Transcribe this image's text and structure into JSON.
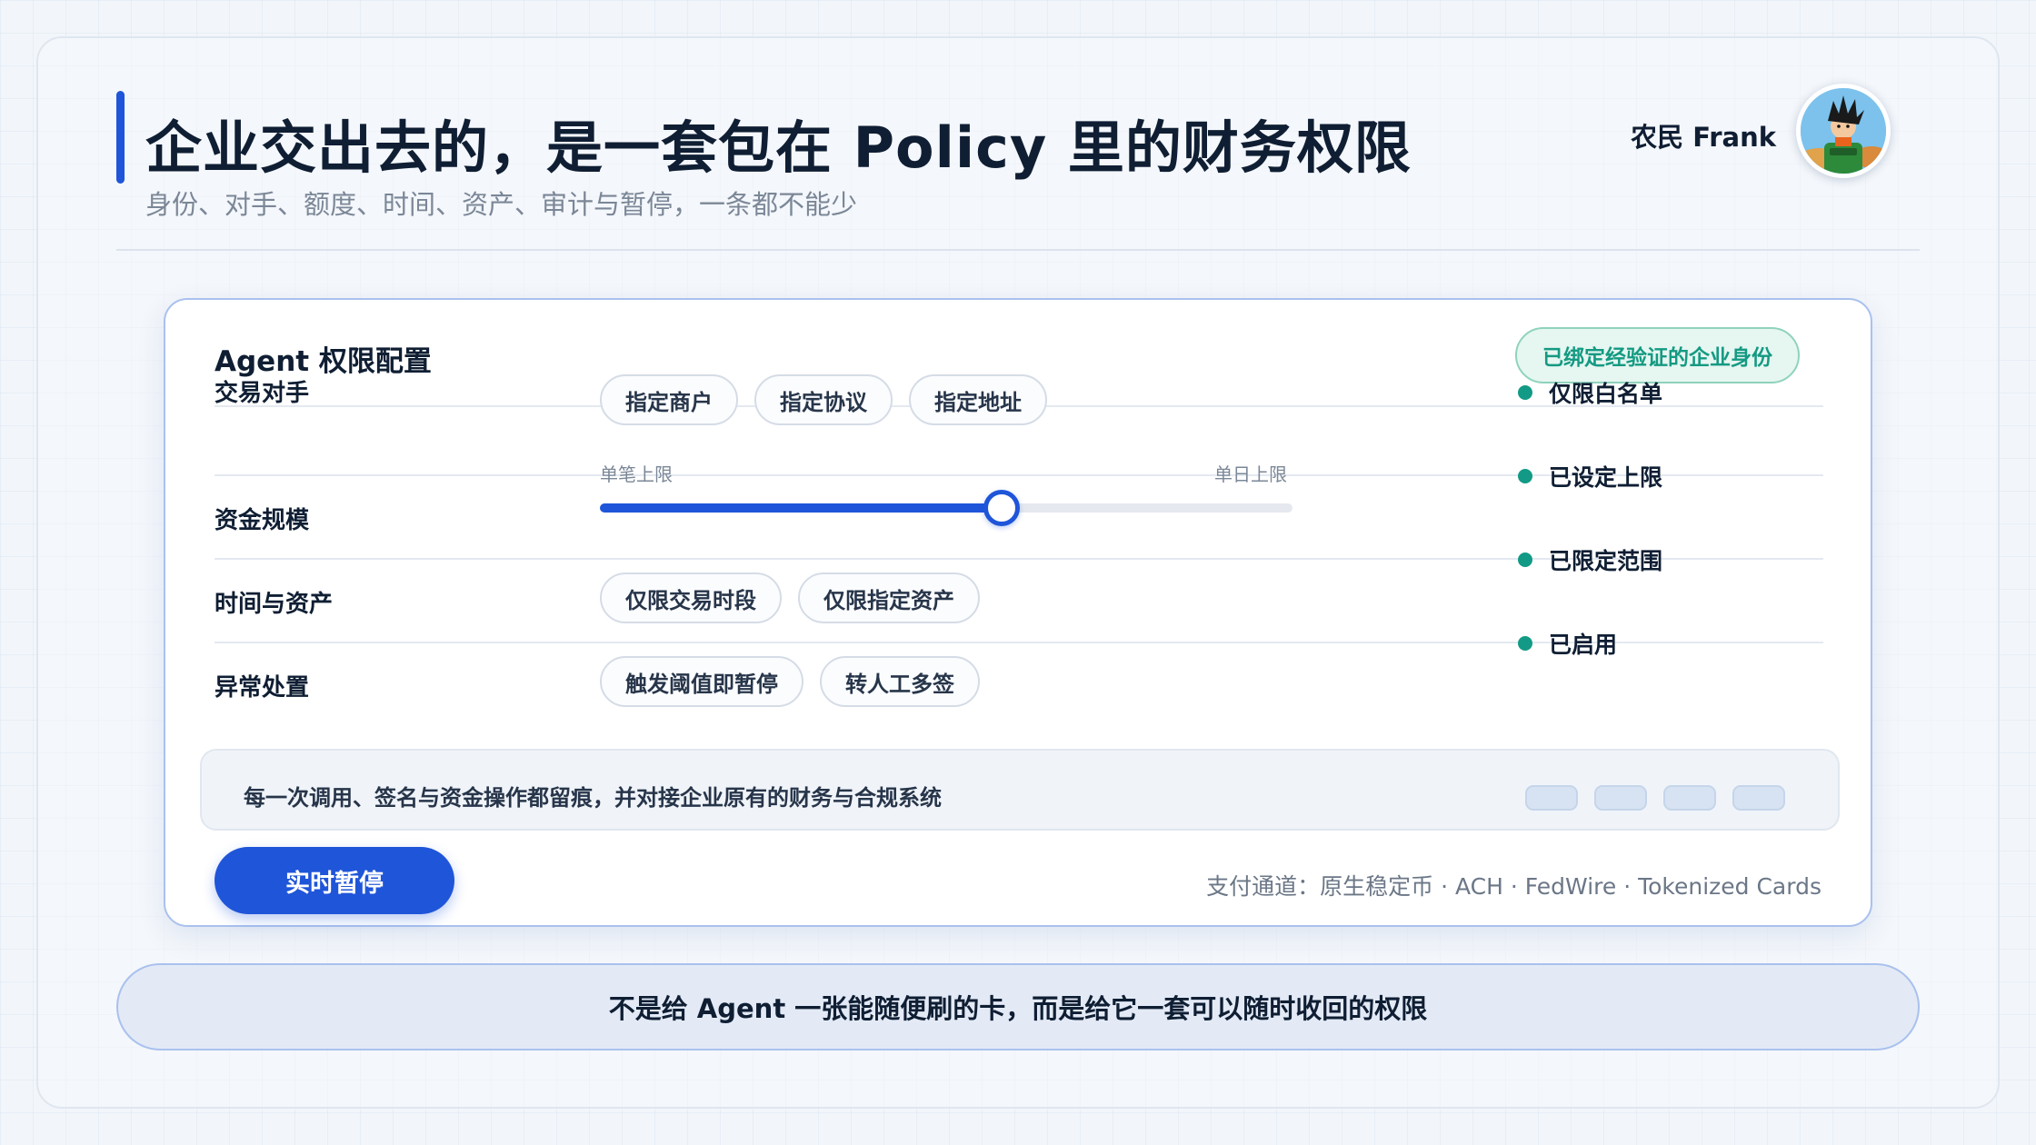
{
  "header": {
    "title": "企业交出去的，是一套包在 Policy 里的财务权限",
    "subtitle": "身份、对手、额度、时间、资产、审计与暂停，一条都不能少",
    "author": "农民 Frank",
    "avatar_icon": "cartoon-avatar-icon"
  },
  "card": {
    "title": "Agent 权限配置",
    "badge": "已绑定经验证的企业身份",
    "rows": [
      {
        "label": "交易对手",
        "chips": [
          "指定商户",
          "指定协议",
          "指定地址"
        ],
        "status": "仅限白名单"
      },
      {
        "label": "资金规模",
        "slider": {
          "min_label": "单笔上限",
          "max_label": "单日上限",
          "value_fraction": 0.58
        },
        "status": "已设定上限"
      },
      {
        "label": "时间与资产",
        "chips": [
          "仅限交易时段",
          "仅限指定资产"
        ],
        "status": "已限定范围"
      },
      {
        "label": "异常处置",
        "chips": [
          "触发阈值即暂停",
          "转人工多签"
        ],
        "status": "已启用"
      }
    ],
    "status_color": "#129a86",
    "audit_text": "每一次调用、签名与资金操作都留痕，并对接企业原有的财务与合规系统",
    "pause_button": "实时暂停",
    "channels": "支付通道：原生稳定币 · ACH · FedWire · Tokenized Cards"
  },
  "footer": {
    "text": "不是给 Agent 一张能随便刷的卡，而是给它一套可以随时收回的权限"
  },
  "colors": {
    "accent": "#1f55d9",
    "status_green": "#129a86",
    "badge_text": "#149a82"
  }
}
